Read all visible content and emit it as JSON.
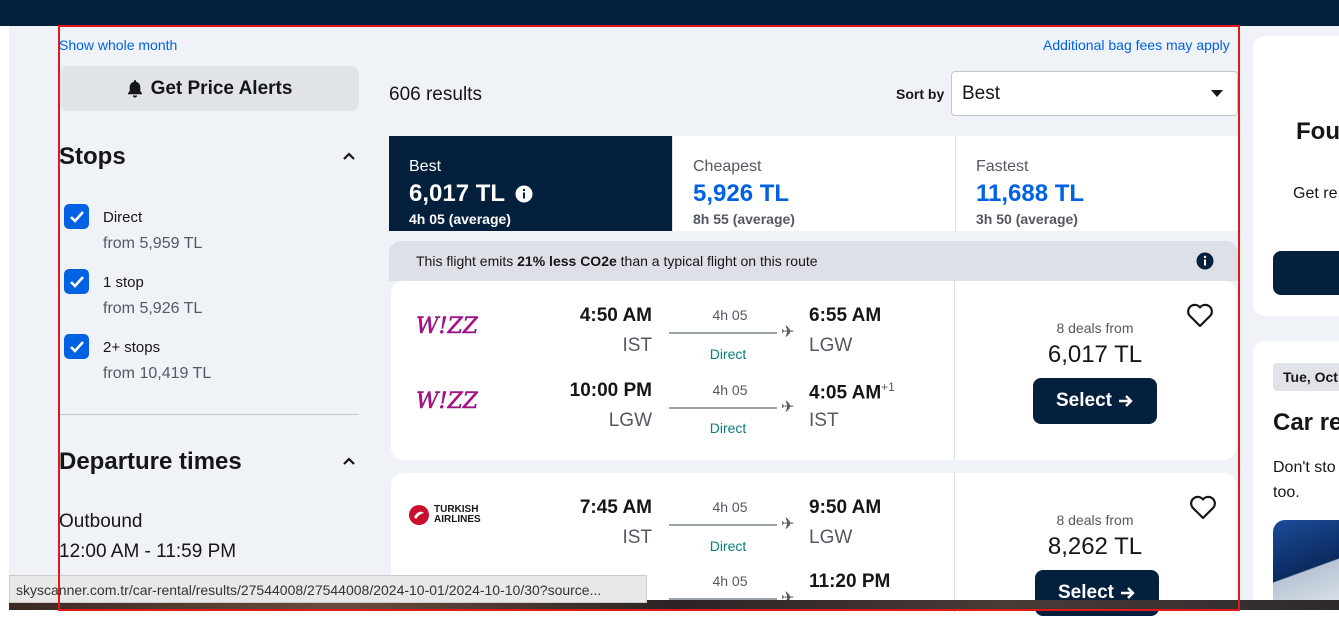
{
  "topbar": {},
  "links": {
    "show_month": "Show whole month",
    "bag_fees": "Additional bag fees may apply"
  },
  "sidebar": {
    "price_alert_label": "Get Price Alerts",
    "stops_title": "Stops",
    "stops": [
      {
        "label": "Direct",
        "price": "from 5,959 TL",
        "checked": true
      },
      {
        "label": "1 stop",
        "price": "from 5,926 TL",
        "checked": true
      },
      {
        "label": "2+ stops",
        "price": "from 10,419 TL",
        "checked": true
      }
    ],
    "departure_title": "Departure times",
    "outbound_label": "Outbound",
    "outbound_range": "12:00 AM - 11:59 PM"
  },
  "results": {
    "count": "606 results",
    "sort_label": "Sort by",
    "sort_value": "Best"
  },
  "tabs": [
    {
      "name": "Best",
      "price": "6,017 TL",
      "sub": "4h 05 (average)",
      "active": true
    },
    {
      "name": "Cheapest",
      "price": "5,926 TL",
      "sub": "8h 55 (average)",
      "active": false
    },
    {
      "name": "Fastest",
      "price": "11,688 TL",
      "sub": "3h 50 (average)",
      "active": false
    }
  ],
  "co2": {
    "prefix": "This flight emits ",
    "highlight": "21% less CO2e",
    "suffix": " than a typical flight on this route"
  },
  "cards": [
    {
      "airline": "Wizz Air",
      "legs": [
        {
          "dep_time": "4:50 AM",
          "dep_code": "IST",
          "duration": "4h 05",
          "stops": "Direct",
          "arr_time": "6:55 AM",
          "arr_code": "LGW",
          "day_offset": ""
        },
        {
          "dep_time": "10:00 PM",
          "dep_code": "LGW",
          "duration": "4h 05",
          "stops": "Direct",
          "arr_time": "4:05 AM",
          "arr_code": "IST",
          "day_offset": "+1"
        }
      ],
      "deals": "8 deals from",
      "price": "6,017 TL",
      "select_label": "Select"
    },
    {
      "airline": "Turkish Airlines",
      "airline_line1": "TURKISH",
      "airline_line2": "AIRLINES",
      "legs": [
        {
          "dep_time": "7:45 AM",
          "dep_code": "IST",
          "duration": "4h 05",
          "stops": "Direct",
          "arr_time": "9:50 AM",
          "arr_code": "LGW",
          "day_offset": ""
        },
        {
          "dep_time": "",
          "dep_code": "",
          "duration": "4h 05",
          "stops": "",
          "arr_time": "11:20 PM",
          "arr_code": "",
          "day_offset": ""
        }
      ],
      "deals": "8 deals from",
      "price": "8,262 TL",
      "select_label": "Select"
    }
  ],
  "right_column": {
    "card1_title": "Fou",
    "card1_text": "Get re",
    "card2_date": "Tue, Oct",
    "card2_title": "Car re",
    "card2_text1": "Don't sto",
    "card2_text2": "too."
  },
  "status_bar": {
    "url": "skyscanner.com.tr/car-rental/results/27544008/27544008/2024-10-01/2024-10-10/30?source..."
  },
  "colors": {
    "navy": "#05203c",
    "accent_blue": "#0062e3",
    "direct_teal": "#0a7e7e",
    "highlight_red": "#e01a1a"
  }
}
